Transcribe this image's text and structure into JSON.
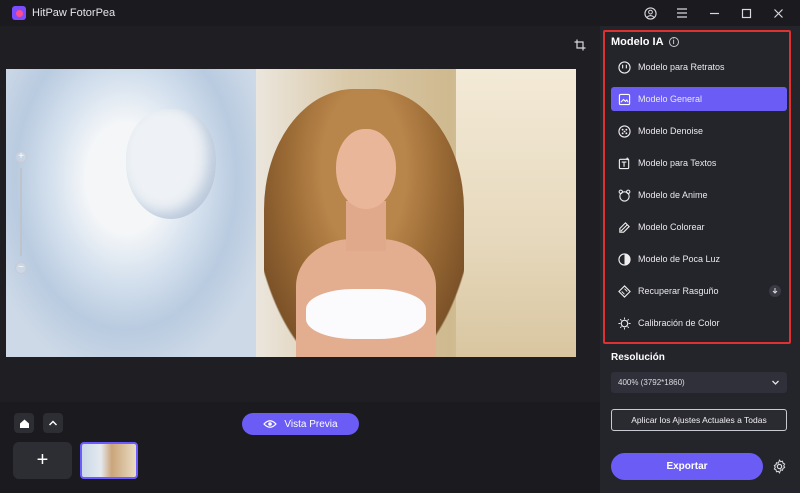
{
  "app": {
    "title": "HitPaw FotorPea"
  },
  "panel": {
    "title": "Modelo IA",
    "models": [
      {
        "label": "Modelo para Retratos",
        "icon": "portrait-face-icon",
        "active": false
      },
      {
        "label": "Modelo General",
        "icon": "image-icon",
        "active": true
      },
      {
        "label": "Modelo Denoise",
        "icon": "denoise-icon",
        "active": false
      },
      {
        "label": "Modelo para Textos",
        "icon": "text-icon",
        "active": false
      },
      {
        "label": "Modelo de Anime",
        "icon": "anime-icon",
        "active": false
      },
      {
        "label": "Modelo Colorear",
        "icon": "colorize-icon",
        "active": false
      },
      {
        "label": "Modelo de Poca Luz",
        "icon": "low-light-icon",
        "active": false
      },
      {
        "label": "Recuperar Rasguño",
        "icon": "scratch-repair-icon",
        "active": false,
        "download": true
      },
      {
        "label": "Calibración de Color",
        "icon": "color-calibration-icon",
        "active": false
      }
    ],
    "resolution_label": "Resolución",
    "resolution_value": "400% (3792*1860)",
    "apply_label": "Aplicar los Ajustes Actuales a Todas",
    "export_label": "Exportar"
  },
  "preview": {
    "label": "Vista Previa"
  },
  "colors": {
    "accent": "#6b5cf5",
    "highlight_border": "#e0302f",
    "panel_bg": "#24242b"
  }
}
